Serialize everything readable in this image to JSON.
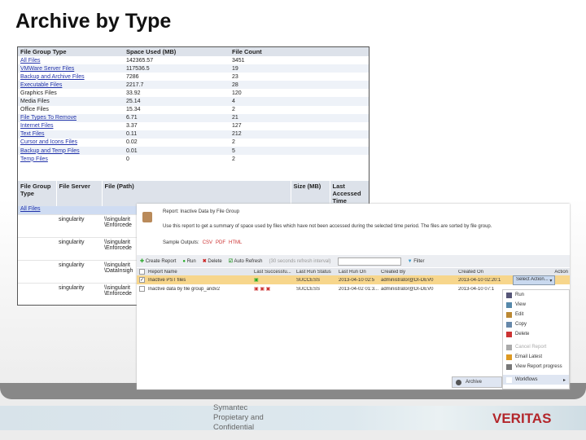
{
  "title": "Archive by Type",
  "summary_table": {
    "headers": [
      "File Group Type",
      "Space Used (MB)",
      "File Count"
    ],
    "rows": [
      [
        "All Files",
        "142365.57",
        "3451"
      ],
      [
        "VMWare Server Files",
        "117536.5",
        "19"
      ],
      [
        "Backup and Archive Files",
        "7286",
        "23"
      ],
      [
        "Executable Files",
        "2217.7",
        "28"
      ],
      [
        "Graphics Files",
        "33.92",
        "120"
      ],
      [
        "Media Files",
        "25.14",
        "4"
      ],
      [
        "Office Files",
        "15.34",
        "2"
      ],
      [
        "File Types To Remove",
        "6.71",
        "21"
      ],
      [
        "Internet Files",
        "3.37",
        "127"
      ],
      [
        "Text Files",
        "0.11",
        "212"
      ],
      [
        "Cursor and Icons Files",
        "0.02",
        "2"
      ],
      [
        "Backup and Temp Files",
        "0.01",
        "5"
      ],
      [
        "Temp Files",
        "0",
        "2"
      ]
    ]
  },
  "detail_table": {
    "headers": [
      "File Group Type",
      "File Server",
      "File (Path)",
      "Size (MB)",
      "Last Accessed Time"
    ],
    "group": "All Files",
    "rows": [
      [
        "singularity",
        "\\\\singularit",
        "\\Enforcede"
      ],
      [
        "singularity",
        "\\\\singularit",
        "\\Enforcede"
      ],
      [
        "singularity",
        "\\\\singularit",
        "\\DataInsigh"
      ],
      [
        "singularity",
        "\\\\singularit",
        "\\Enforcede"
      ]
    ]
  },
  "report": {
    "title": "Report: Inactive Data by File Group",
    "description": "Use this report to get a summary of space used by files which have not been accessed during the selected time period. The files are sorted by file group.",
    "sample_label": "Sample Outputs:",
    "outputs": [
      "CSV",
      "PDF",
      "HTML"
    ]
  },
  "toolbar": {
    "create": "Create Report",
    "run": "Run",
    "delete": "Delete",
    "auto_refresh": "Auto Refresh",
    "interval": "(30 seconds refresh interval)",
    "filter": "Filter"
  },
  "grid": {
    "headers": [
      "Report Name",
      "Last Successfu...",
      "Last Run Status",
      "Last Run On",
      "Created By",
      "Created On",
      "Action"
    ],
    "rows": [
      {
        "name": "Inactive PST files",
        "status": "SUCCESS",
        "run_on": "2013-04-10 02:5",
        "by": "administrator@DI-DEV0",
        "created": "2013-04-10 02:20:1",
        "checked": true
      },
      {
        "name": "Inactive data by file group_andv2",
        "status": "SUCCESS",
        "run_on": "2013-04-02 01:3...",
        "by": "administrator@DI-DEV0",
        "created": "2013-04-10 07:1",
        "checked": false
      }
    ],
    "select_action": "Select Action..."
  },
  "menu": [
    "Run",
    "View",
    "Edit",
    "Copy",
    "Delete",
    "Cancel Report",
    "Email Latest",
    "View Report progress",
    "Workflows"
  ],
  "submenu": "Archive",
  "footer": {
    "line1": "Symantec",
    "line2": "Propietary and",
    "line3": "Confidential",
    "logo": "VERITAS"
  }
}
